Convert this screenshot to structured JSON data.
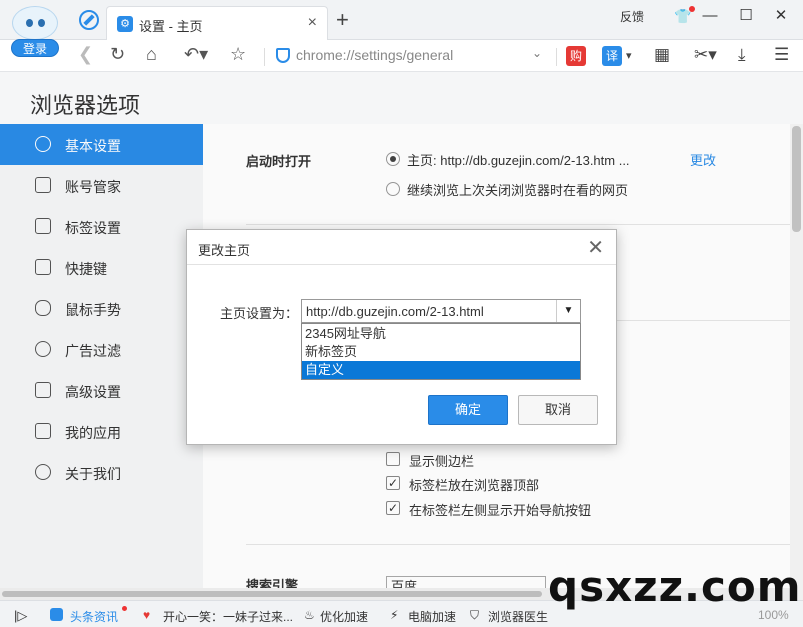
{
  "titlebar": {
    "login_label": "登录",
    "tab_title": "设置 - 主页",
    "tab_close": "×",
    "new_tab": "+",
    "feedback": "反馈",
    "minimize": "—",
    "maximize": "☐",
    "close": "✕"
  },
  "addressbar": {
    "url": "chrome://settings/general",
    "buy_label": "购",
    "translate_label": "译"
  },
  "page": {
    "title": "浏览器选项"
  },
  "sidebar": {
    "items": [
      {
        "label": "基本设置",
        "active": true
      },
      {
        "label": "账号管家"
      },
      {
        "label": "标签设置"
      },
      {
        "label": "快捷键"
      },
      {
        "label": "鼠标手势"
      },
      {
        "label": "广告过滤"
      },
      {
        "label": "高级设置"
      },
      {
        "label": "我的应用"
      },
      {
        "label": "关于我们"
      }
    ]
  },
  "settings": {
    "startup_title": "启动时打开",
    "startup_home": "主页: http://db.guzejin.com/2-13.htm ...",
    "startup_change": "更改",
    "startup_restore": "继续浏览上次关闭浏览器时在看的网页",
    "show_sidebar": "显示侧边栏",
    "tabs_on_top": "标签栏放在浏览器顶部",
    "nav_left": "在标签栏左侧显示开始导航按钮",
    "search_title": "搜索引擎",
    "search_engine": "百度"
  },
  "modal": {
    "title": "更改主页",
    "field_label": "主页设置为：",
    "current_value": "http://db.guzejin.com/2-13.html",
    "options": [
      "2345网址导航",
      "新标签页",
      "自定义"
    ],
    "selected_option": "自定义",
    "ok_label": "确定",
    "cancel_label": "取消"
  },
  "statusbar": {
    "news": "头条资讯",
    "joke": "开心一笑：一妹子过来...",
    "optimize": "优化加速",
    "pc_speed": "电脑加速",
    "doctor": "浏览器医生",
    "zoom": "100%"
  },
  "watermark": "qsxzz.com"
}
